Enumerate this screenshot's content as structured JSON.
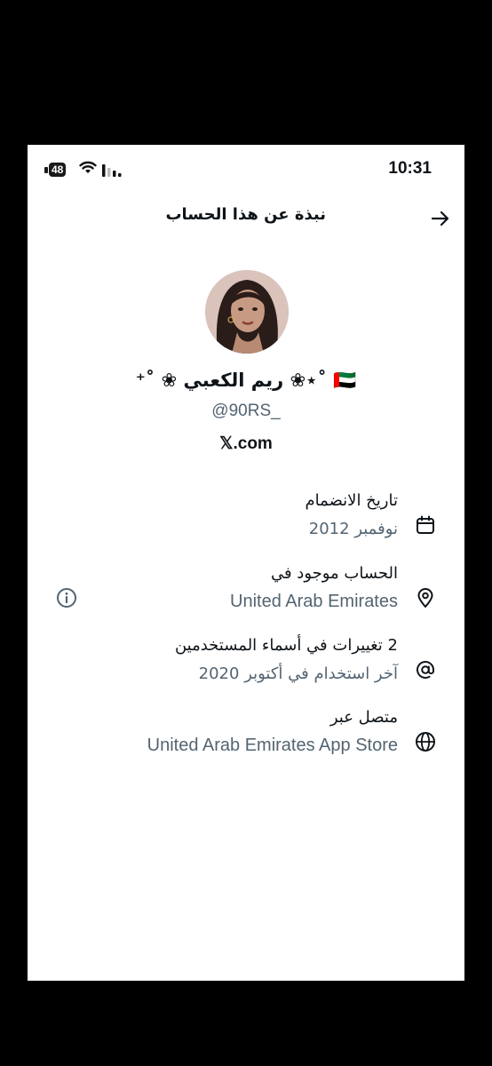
{
  "status_bar": {
    "battery": "48",
    "time": "10:31"
  },
  "header": {
    "title": "نبذة عن هذا الحساب"
  },
  "profile": {
    "display_name": "⁺˚ ❀ ريم الكعبي ❀⋆˚ 🇦🇪",
    "handle": "@90RS_",
    "site": "𝕏.com"
  },
  "info": {
    "joined": {
      "title": "تاريخ الانضمام",
      "value": "نوفمبر 2012",
      "icon": "calendar-icon"
    },
    "location": {
      "title": "الحساب موجود في",
      "value": "United Arab Emirates",
      "icon": "location-pin-icon"
    },
    "username_changes": {
      "title": "2 تغييرات في أسماء المستخدمين",
      "value": "آخر استخدام في أكتوبر 2020",
      "icon": "at-sign-icon"
    },
    "connected_via": {
      "title": "متصل عبر",
      "value": "United Arab Emirates App Store",
      "icon": "globe-icon"
    }
  },
  "colors": {
    "text": "#0f1419",
    "secondary": "#536471",
    "background": "#ffffff"
  }
}
